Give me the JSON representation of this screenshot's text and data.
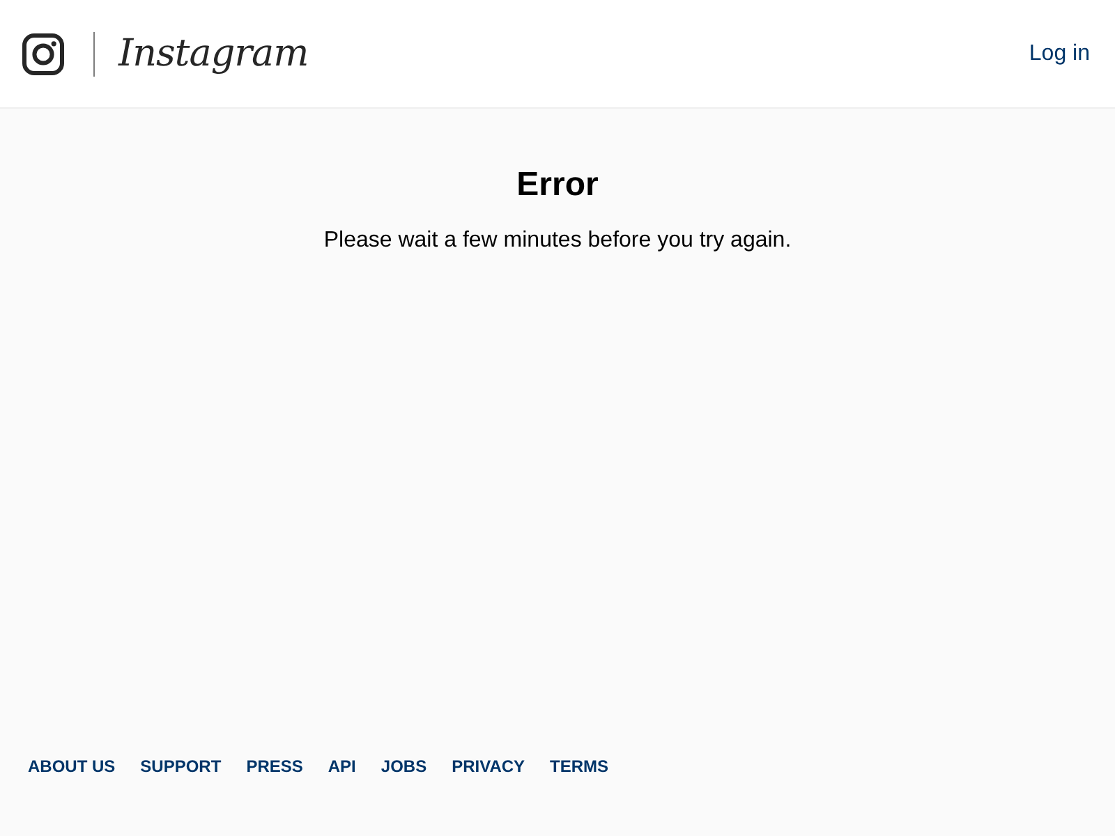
{
  "header": {
    "logo_text": "Instagram",
    "login_link": "Log in"
  },
  "error": {
    "title": "Error",
    "message": "Please wait a few minutes before you try again."
  },
  "footer": {
    "links": [
      "ABOUT US",
      "SUPPORT",
      "PRESS",
      "API",
      "JOBS",
      "PRIVACY",
      "TERMS"
    ]
  }
}
